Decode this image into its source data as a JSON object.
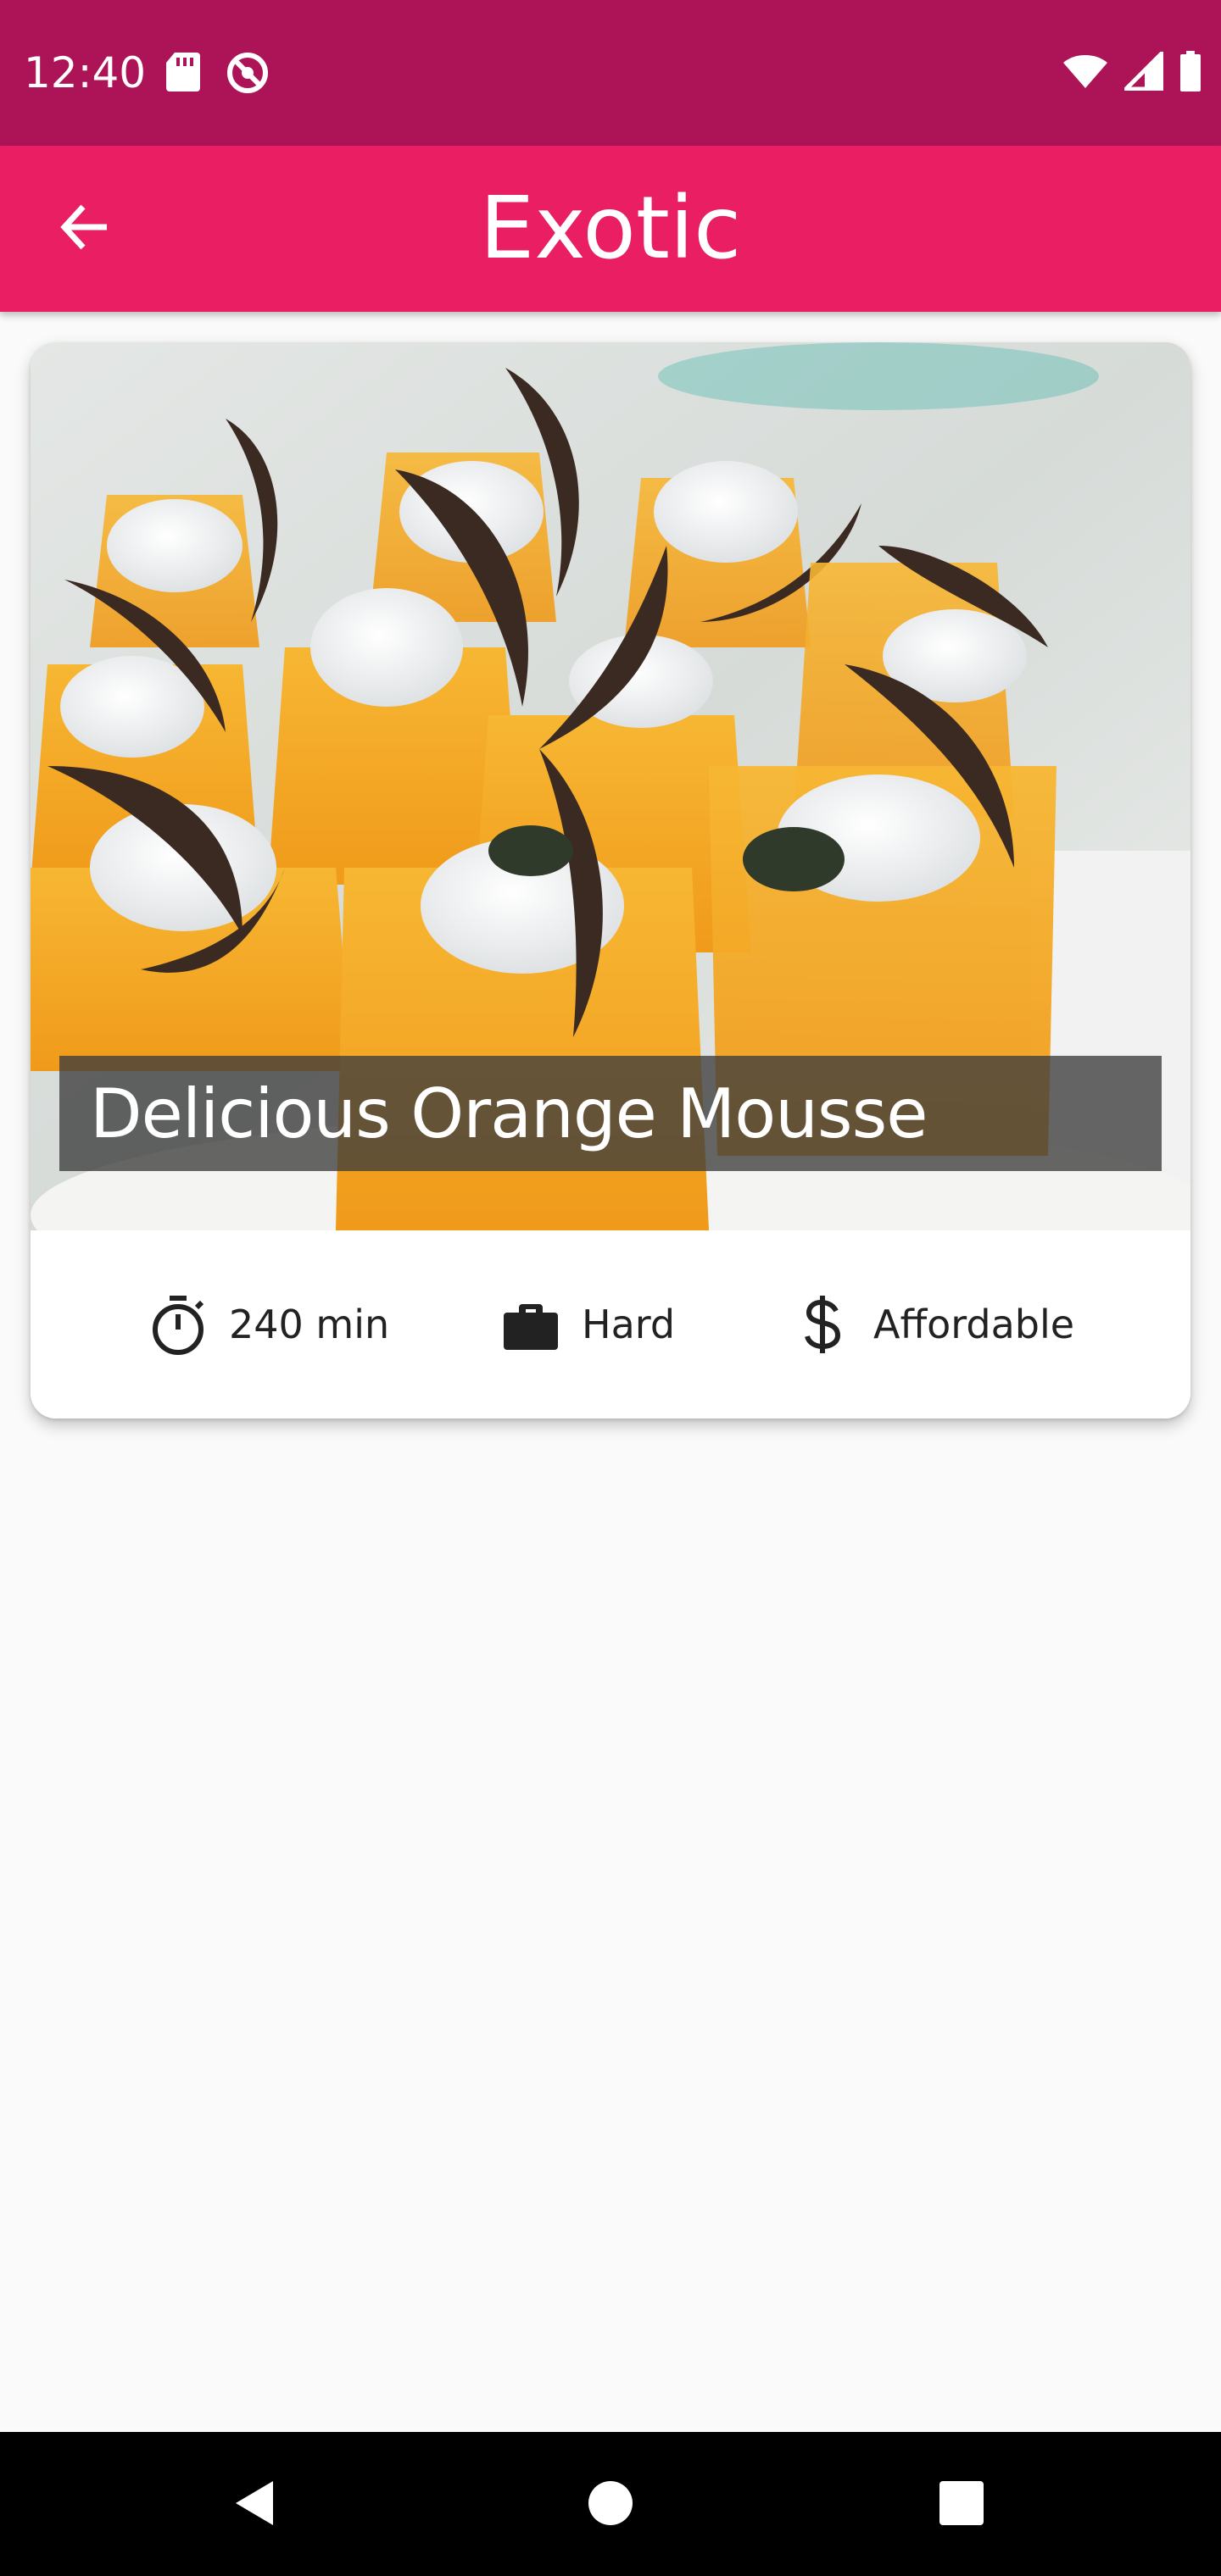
{
  "status_bar": {
    "time": "12:40",
    "left_icons": [
      "sd-card-icon",
      "do-not-disturb-icon"
    ],
    "right_icons": [
      "wifi-icon",
      "signal-icon",
      "battery-icon"
    ],
    "background_color": "#ad1457"
  },
  "app_bar": {
    "title": "Exotic",
    "back_icon": "arrow-back-icon",
    "background_color": "#e91e63"
  },
  "meal_card": {
    "title": "Delicious Orange Mousse",
    "duration": "240 min",
    "complexity": "Hard",
    "affordability": "Affordable",
    "icons": {
      "duration": "timer-icon",
      "complexity": "briefcase-icon",
      "affordability": "dollar-icon"
    }
  },
  "nav_bar": {
    "buttons": [
      "back-triangle-icon",
      "home-circle-icon",
      "recents-square-icon"
    ]
  }
}
